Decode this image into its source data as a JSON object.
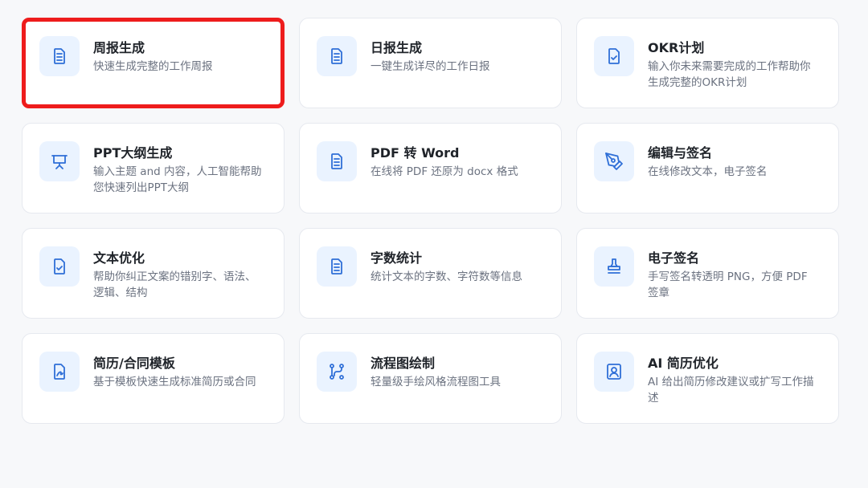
{
  "cards": [
    {
      "title": "周报生成",
      "desc": "快速生成完整的工作周报",
      "icon": "document-icon"
    },
    {
      "title": "日报生成",
      "desc": "一键生成详尽的工作日报",
      "icon": "document-icon"
    },
    {
      "title": "OKR计划",
      "desc": "输入你未来需要完成的工作帮助你生成完整的OKR计划",
      "icon": "document-check-icon"
    },
    {
      "title": "PPT大纲生成",
      "desc": "输入主题 and 内容，人工智能帮助您快速列出PPT大纲",
      "icon": "presentation-icon"
    },
    {
      "title": "PDF 转 Word",
      "desc": "在线将 PDF 还原为 docx 格式",
      "icon": "document-icon"
    },
    {
      "title": "编辑与签名",
      "desc": "在线修改文本，电子签名",
      "icon": "pen-nib-icon"
    },
    {
      "title": "文本优化",
      "desc": "帮助你纠正文案的错别字、语法、逻辑、结构",
      "icon": "document-check-icon"
    },
    {
      "title": "字数统计",
      "desc": "统计文本的字数、字符数等信息",
      "icon": "document-icon"
    },
    {
      "title": "电子签名",
      "desc": "手写签名转透明 PNG，方便 PDF 签章",
      "icon": "stamp-icon"
    },
    {
      "title": "简历/合同模板",
      "desc": "基于模板快速生成标准简历或合同",
      "icon": "file-signature-icon"
    },
    {
      "title": "流程图绘制",
      "desc": "轻量级手绘风格流程图工具",
      "icon": "flow-icon"
    },
    {
      "title": "AI 简历优化",
      "desc": "AI 给出简历修改建议或扩写工作描述",
      "icon": "user-portrait-icon"
    }
  ],
  "highlighted_card": "周报生成",
  "colors": {
    "accent": "#2f6fd7",
    "icon_bg": "#eaf3ff",
    "highlight_border": "#ee1c1c"
  }
}
